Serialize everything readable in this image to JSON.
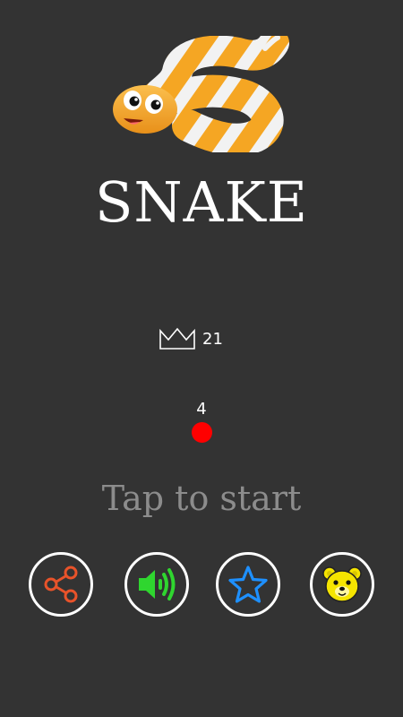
{
  "game": {
    "title": "SNAKE",
    "best_score": "21",
    "ball_count": "4",
    "prompt": "Tap to start"
  },
  "icons": {
    "logo": "snake-logo",
    "best_score": "crown-icon",
    "share": "share-icon",
    "sound": "speaker-icon",
    "rate": "star-icon",
    "more_games": "bear-icon"
  },
  "colors": {
    "background": "#333333",
    "title": "#ffffff",
    "prompt": "#8c8c8c",
    "ball": "#ff0000",
    "button_border": "#ffffff",
    "share_icon": "#e8532a",
    "sound_icon": "#2fd62f",
    "star_icon": "#1e90ff",
    "bear_icon": "#f5e400",
    "snake_orange": "#f5a623",
    "snake_white": "#f2f2f2"
  }
}
